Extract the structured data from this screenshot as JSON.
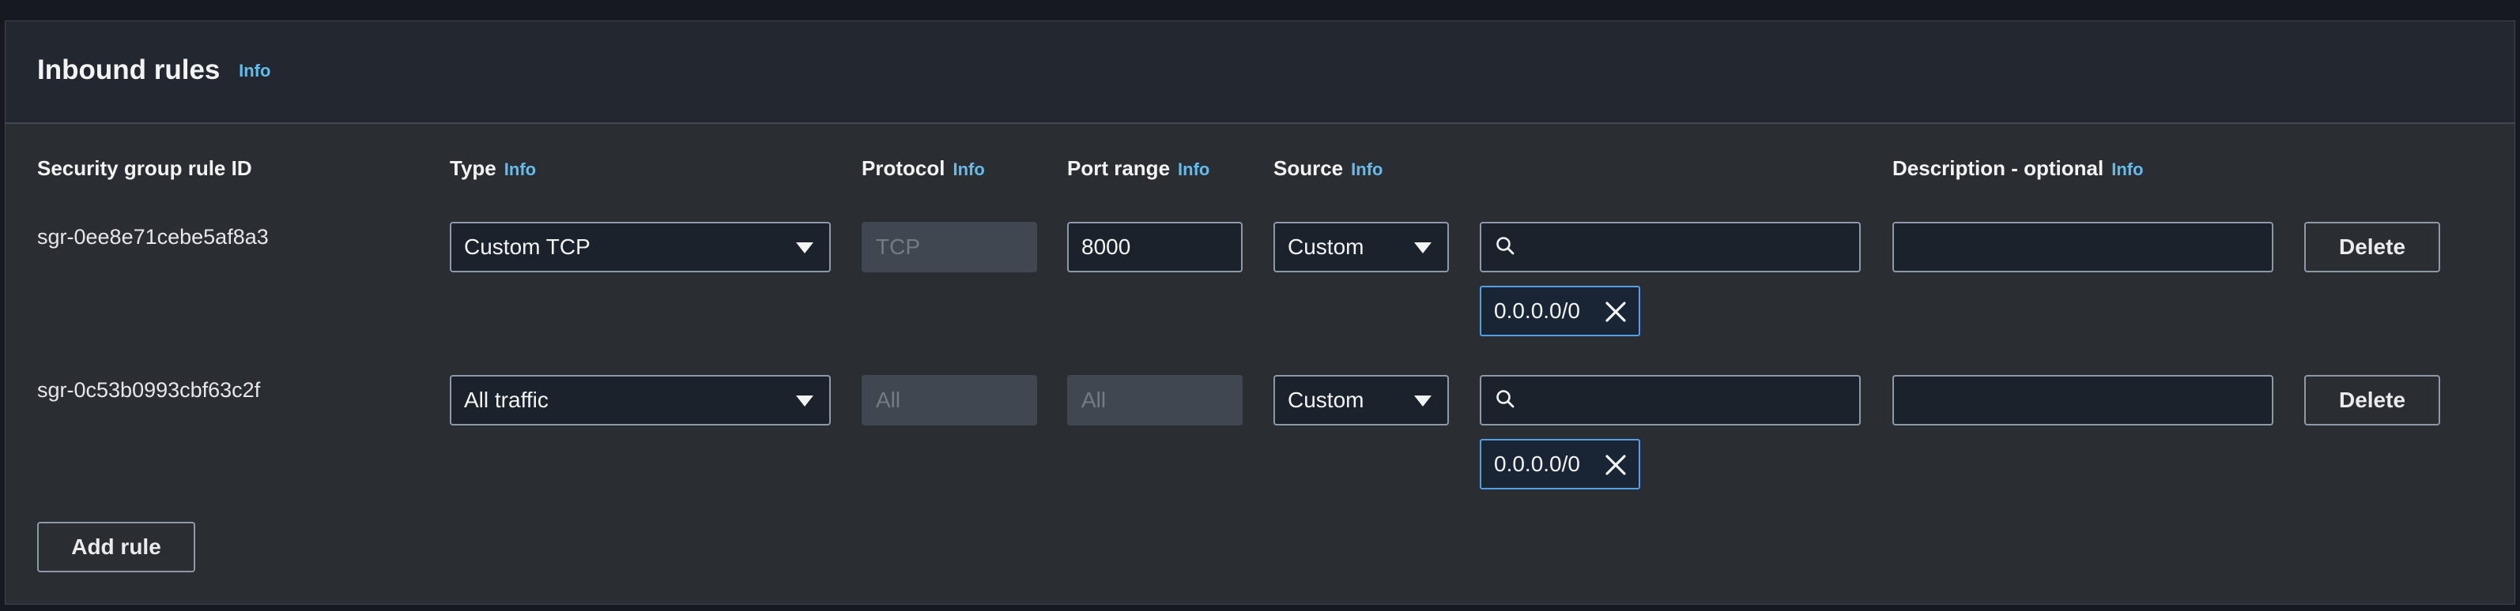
{
  "section": {
    "title": "Inbound rules",
    "info_label": "Info"
  },
  "columns": {
    "rule_id": "Security group rule ID",
    "type": "Type",
    "protocol": "Protocol",
    "port_range": "Port range",
    "source": "Source",
    "description": "Description - optional",
    "info_label": "Info"
  },
  "rules": [
    {
      "id": "sgr-0ee8e71cebe5af8a3",
      "type": "Custom TCP",
      "protocol": "TCP",
      "port_range": "8000",
      "source_mode": "Custom",
      "source_search": "",
      "source_token": "0.0.0.0/0",
      "description": "",
      "delete_label": "Delete"
    },
    {
      "id": "sgr-0c53b0993cbf63c2f",
      "type": "All traffic",
      "protocol": "All",
      "port_range": "All",
      "source_mode": "Custom",
      "source_search": "",
      "source_token": "0.0.0.0/0",
      "description": "",
      "delete_label": "Delete"
    }
  ],
  "add_rule_label": "Add rule",
  "colors": {
    "background": "#16191f",
    "panel": "#2a2e33",
    "header": "#232830",
    "accent_link": "#66bbed",
    "token_border": "#539fe5"
  }
}
